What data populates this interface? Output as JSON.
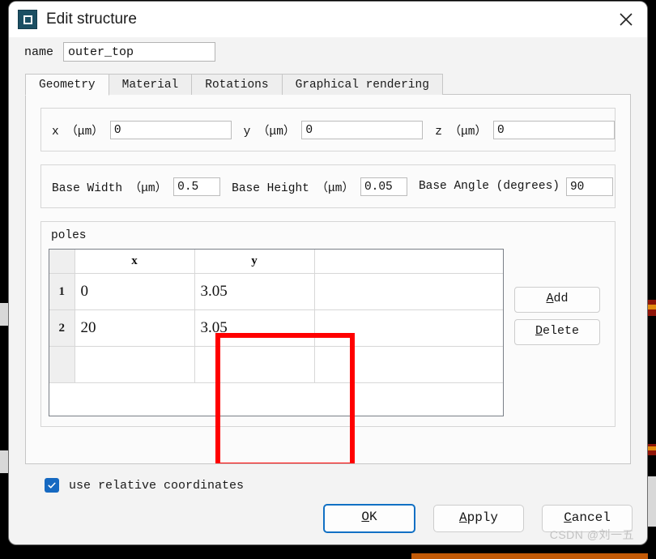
{
  "window": {
    "title": "Edit structure",
    "icon": "structure-icon",
    "close_icon": "close-icon"
  },
  "name_field": {
    "label": "name",
    "value": "outer_top",
    "placeholder": ""
  },
  "tabs": [
    {
      "label": "Geometry",
      "active": true
    },
    {
      "label": "Material",
      "active": false
    },
    {
      "label": "Rotations",
      "active": false
    },
    {
      "label": "Graphical rendering",
      "active": false
    }
  ],
  "geometry": {
    "coords": [
      {
        "label": "x （μm）",
        "value": "0"
      },
      {
        "label": "y （μm）",
        "value": "0"
      },
      {
        "label": "z （μm）",
        "value": "0"
      }
    ],
    "base": [
      {
        "label": "Base Width （μm）",
        "value": "0.5"
      },
      {
        "label": "Base Height （μm）",
        "value": "0.05"
      },
      {
        "label": "Base Angle (degrees)",
        "value": "90"
      }
    ],
    "poles": {
      "label": "poles",
      "columns": [
        "",
        "x",
        "y"
      ],
      "rows": [
        {
          "index": "1",
          "x": "0",
          "y": "3.05",
          "selected": true
        },
        {
          "index": "2",
          "x": "20",
          "y": "3.05",
          "selected": false
        }
      ],
      "buttons": [
        {
          "mnemonic": "A",
          "rest": "dd",
          "name": "add"
        },
        {
          "mnemonic": "D",
          "rest": "elete",
          "name": "delete"
        }
      ]
    }
  },
  "relative_coords": {
    "label": "use relative coordinates",
    "checked": true
  },
  "footer": {
    "buttons": [
      {
        "mnemonic": "O",
        "rest": "K",
        "name": "ok",
        "default": true
      },
      {
        "mnemonic": "A",
        "rest": "pply",
        "name": "apply",
        "default": false
      },
      {
        "mnemonic": "C",
        "rest": "ancel",
        "name": "cancel",
        "default": false
      }
    ]
  },
  "watermark": "CSDN @刘一五",
  "colors": {
    "selection_blue": "#3d9ae8",
    "annotation_red": "#ff0000",
    "accent_blue": "#1170c4",
    "checkbox_blue": "#1669c1"
  }
}
